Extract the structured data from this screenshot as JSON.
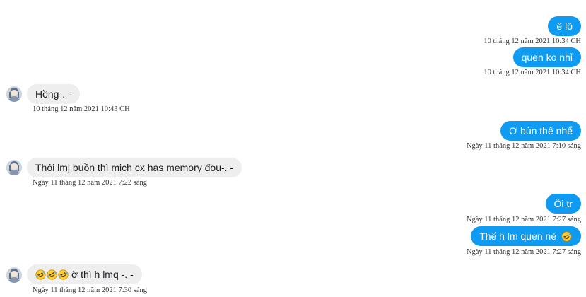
{
  "messages": [
    {
      "text": "ê lô",
      "time": "10 tháng 12 năm 2021 10:34 CH"
    },
    {
      "text": "quen ko nhỉ",
      "time": "10 tháng 12 năm 2021 10:34 CH"
    },
    {
      "text": "Hồng-. -",
      "time": "10 tháng 12 năm 2021 10:43 CH"
    },
    {
      "text": "Ơ bùn thế nhể",
      "time": "Ngày 11 tháng 12 năm 2021 7:10 sáng"
    },
    {
      "text": "Thôi lmj buồn thì mich cx has memory đou-. -",
      "time": "Ngày 11 tháng 12 năm 2021 7:22 sáng"
    },
    {
      "text": "Ôi tr",
      "time": "Ngày 11 tháng 12 năm 2021 7:27 sáng"
    },
    {
      "text": "Thế h lm quen nè",
      "time": "Ngày 11 tháng 12 năm 2021 7:27 sáng"
    },
    {
      "text": "ờ thì h lmq -. -",
      "time": "Ngày 11 tháng 12 năm 2021 7:30 sáng"
    }
  ],
  "colors": {
    "outgoing_bubble": "#0e9bf1",
    "incoming_bubble": "#eeeeef"
  },
  "icons": {
    "emoji": "rolling-on-floor-laughing-emoji",
    "avatar": "contact-avatar"
  }
}
